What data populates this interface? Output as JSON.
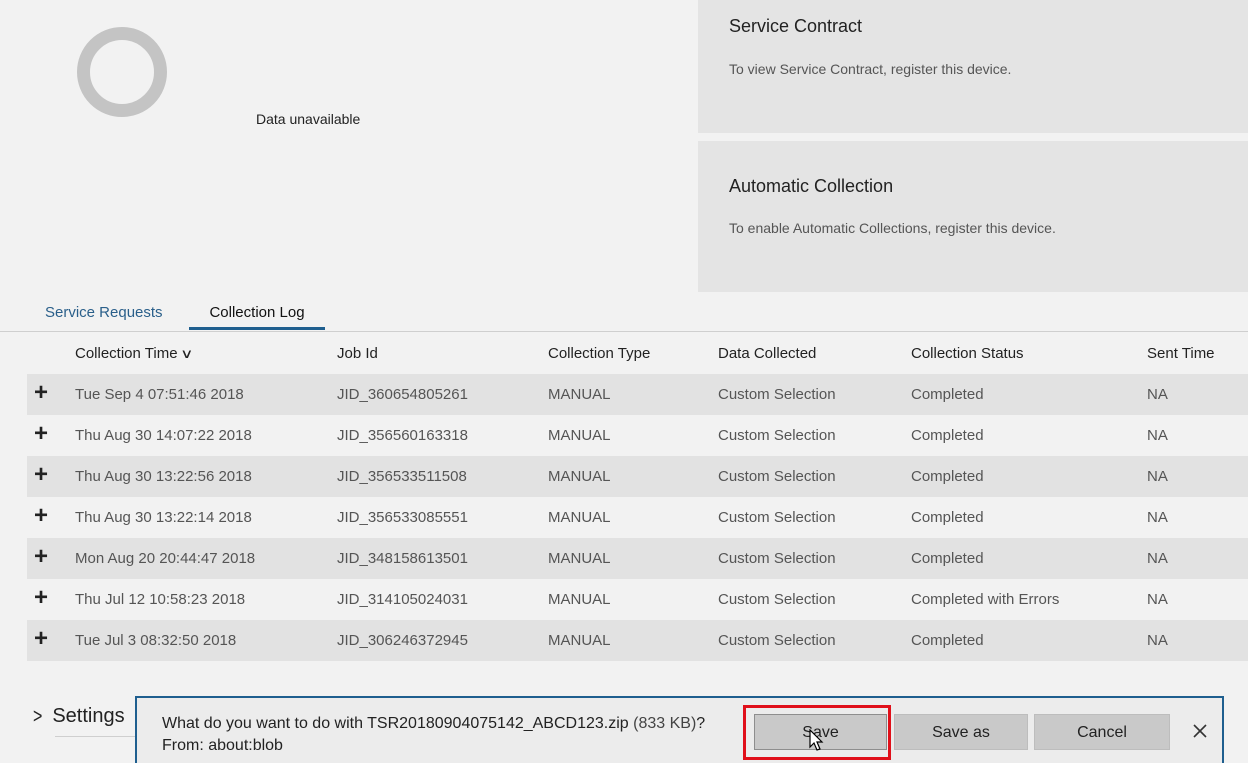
{
  "summary": {
    "donut_label": "Data unavailable"
  },
  "service_contract": {
    "title": "Service Contract",
    "text": "To view Service Contract, register this device."
  },
  "automatic_collection": {
    "title": "Automatic Collection",
    "text": "To enable Automatic Collections, register this device."
  },
  "tabs": [
    {
      "label": "Service Requests"
    },
    {
      "label": "Collection Log",
      "active": true
    }
  ],
  "table": {
    "headers": [
      "Collection Time",
      "Job Id",
      "Collection Type",
      "Data Collected",
      "Collection Status",
      "Sent Time"
    ],
    "rows": [
      {
        "time": "Tue Sep 4 07:51:46 2018",
        "job": "JID_360654805261",
        "type": "MANUAL",
        "data": "Custom Selection",
        "status": "Completed",
        "sent": "NA"
      },
      {
        "time": "Thu Aug 30 14:07:22 2018",
        "job": "JID_356560163318",
        "type": "MANUAL",
        "data": "Custom Selection",
        "status": "Completed",
        "sent": "NA"
      },
      {
        "time": "Thu Aug 30 13:22:56 2018",
        "job": "JID_356533511508",
        "type": "MANUAL",
        "data": "Custom Selection",
        "status": "Completed",
        "sent": "NA"
      },
      {
        "time": "Thu Aug 30 13:22:14 2018",
        "job": "JID_356533085551",
        "type": "MANUAL",
        "data": "Custom Selection",
        "status": "Completed",
        "sent": "NA"
      },
      {
        "time": "Mon Aug 20 20:44:47 2018",
        "job": "JID_348158613501",
        "type": "MANUAL",
        "data": "Custom Selection",
        "status": "Completed",
        "sent": "NA"
      },
      {
        "time": "Thu Jul 12 10:58:23 2018",
        "job": "JID_314105024031",
        "type": "MANUAL",
        "data": "Custom Selection",
        "status": "Completed with Errors",
        "sent": "NA"
      },
      {
        "time": "Tue Jul 3 08:32:50 2018",
        "job": "JID_306246372945",
        "type": "MANUAL",
        "data": "Custom Selection",
        "status": "Completed",
        "sent": "NA"
      }
    ]
  },
  "settings": {
    "label": "Settings"
  },
  "download_bar": {
    "question_prefix": "What do you want to do with ",
    "filename": "TSR20180904075142_ABCD123.zip",
    "size": " (833 KB)",
    "question_suffix": "?",
    "from": "From: about:blob",
    "save_label": "Save",
    "save_as_label": "Save as",
    "cancel_label": "Cancel",
    "highlight_color": "#e0101a"
  }
}
